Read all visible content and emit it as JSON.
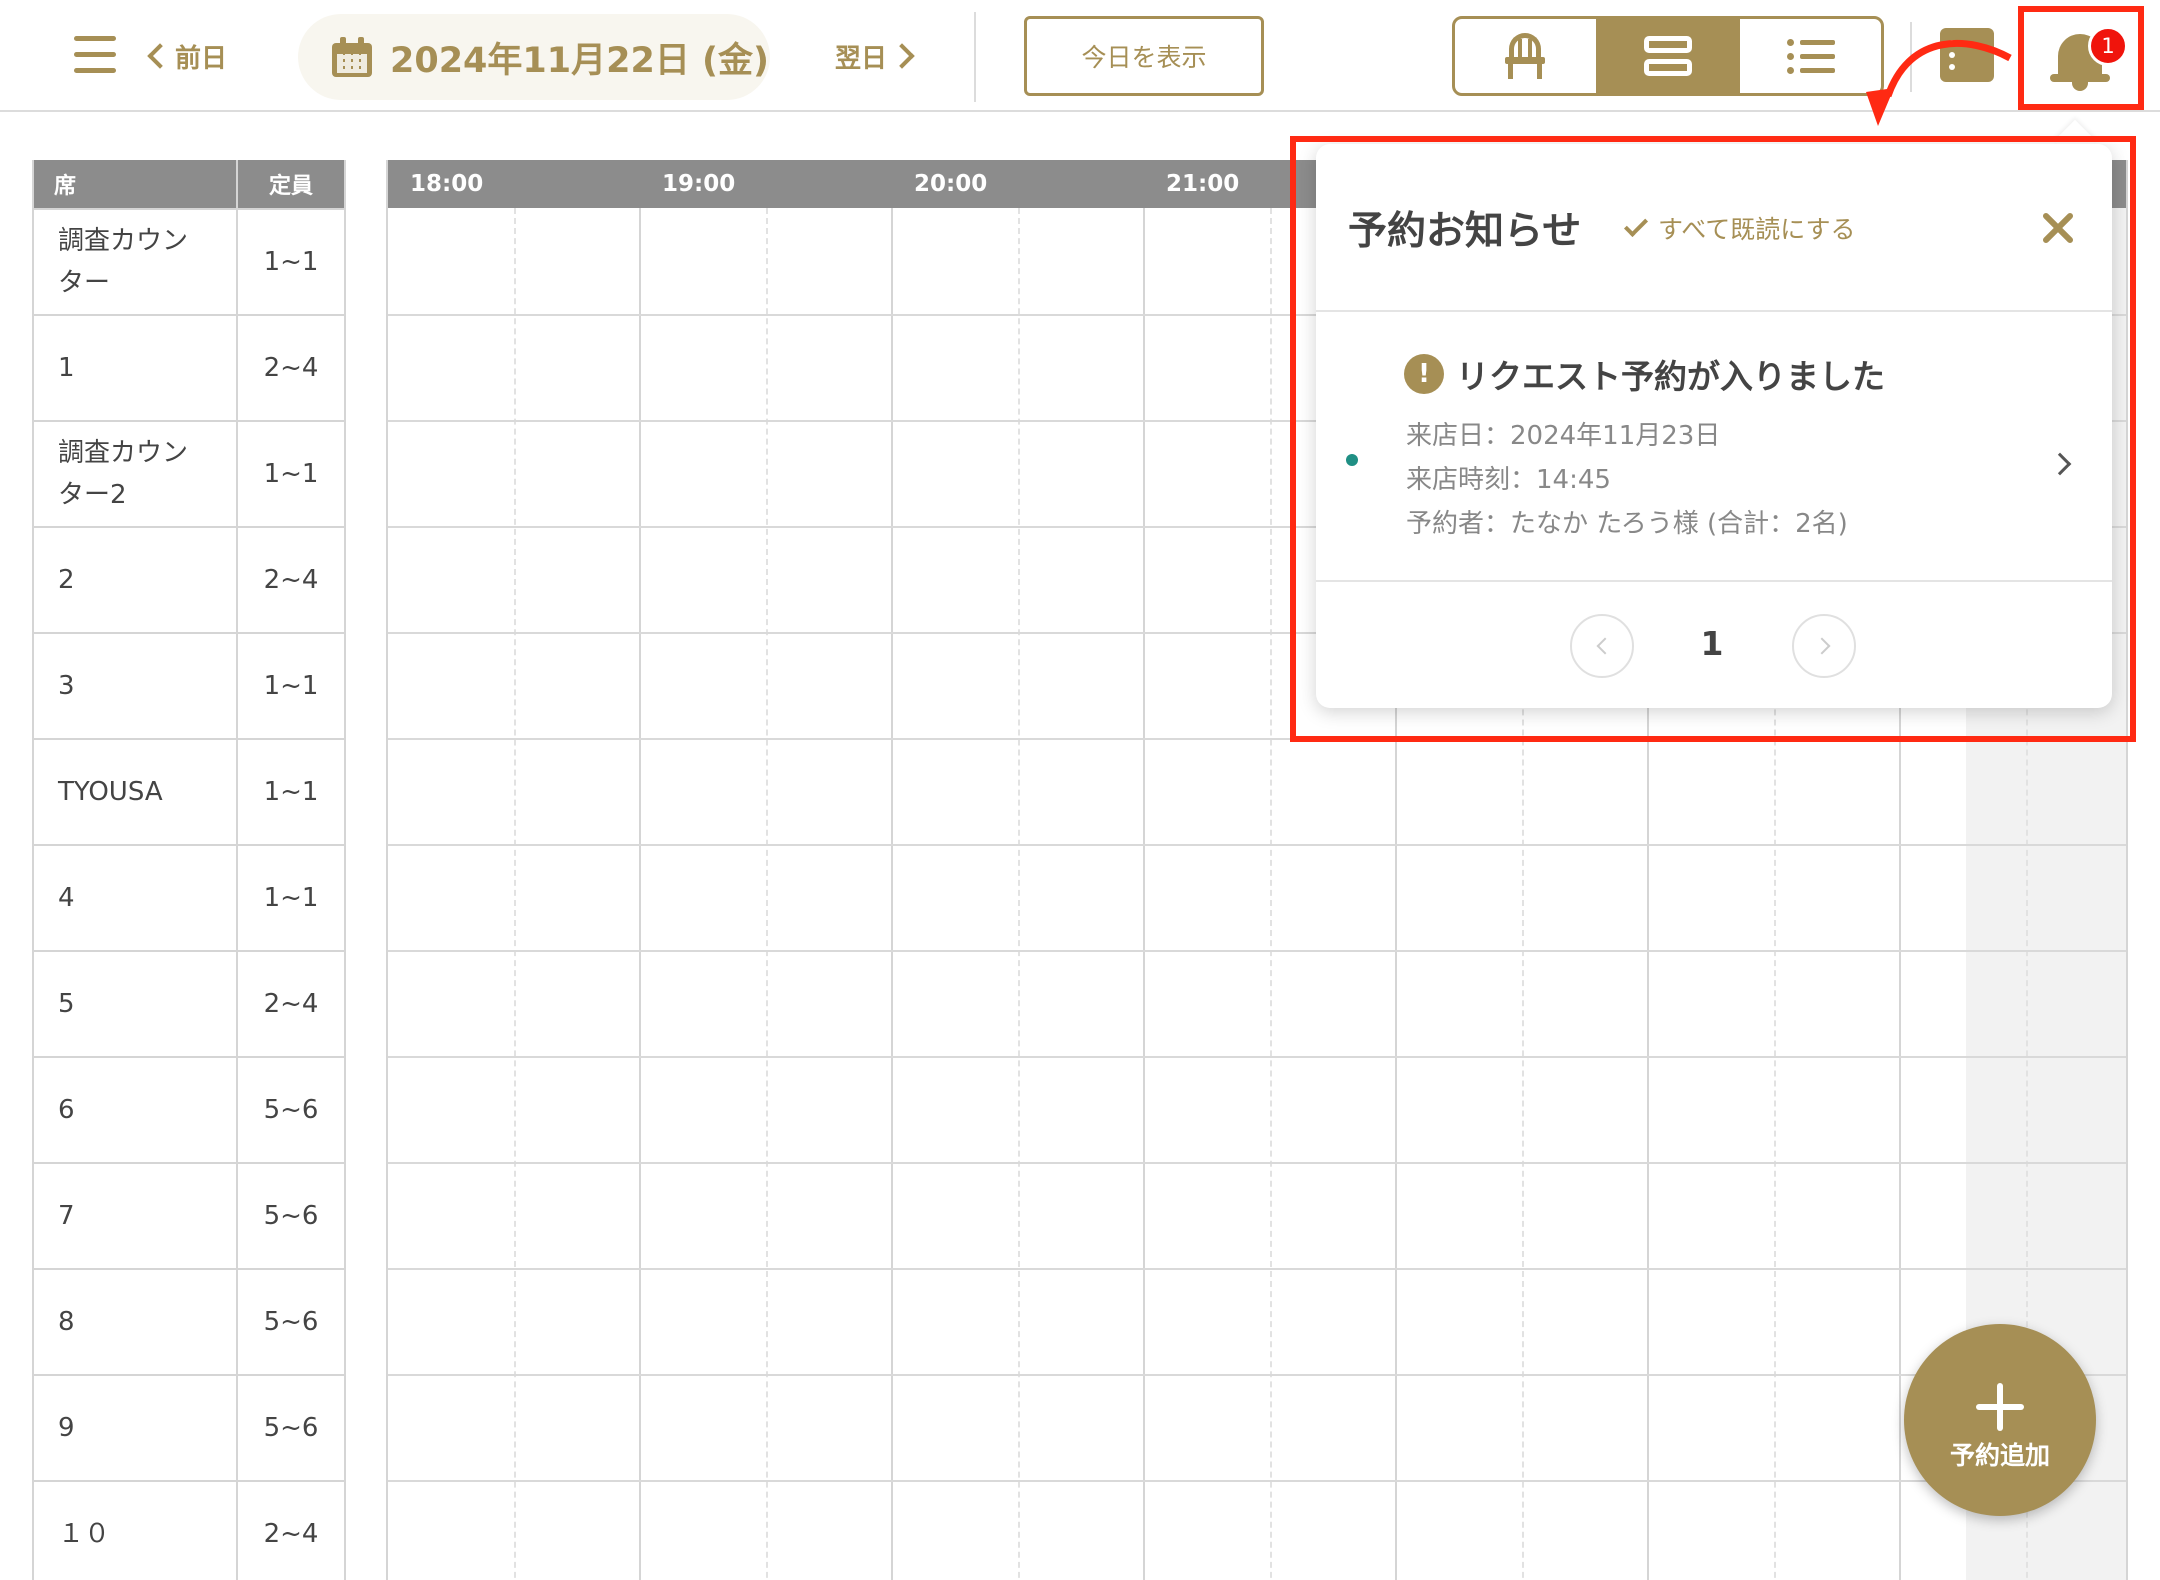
{
  "header": {
    "prev_label": "前日",
    "next_label": "翌日",
    "date": "2024年11月22日 (金)",
    "today_button": "今日を表示",
    "notification_count": "1",
    "view_modes": [
      "chair-icon",
      "rows-icon",
      "list-icon"
    ],
    "active_view": 1
  },
  "seat_table": {
    "col_seat": "席",
    "col_capacity": "定員",
    "rows": [
      {
        "name": "調査カウンター",
        "capacity": "1~1"
      },
      {
        "name": "1",
        "capacity": "2~4"
      },
      {
        "name": "調査カウンター2",
        "capacity": "1~1"
      },
      {
        "name": "2",
        "capacity": "2~4"
      },
      {
        "name": "3",
        "capacity": "1~1"
      },
      {
        "name": "TYOUSA",
        "capacity": "1~1"
      },
      {
        "name": "4",
        "capacity": "1~1"
      },
      {
        "name": "5",
        "capacity": "2~4"
      },
      {
        "name": "6",
        "capacity": "5~6"
      },
      {
        "name": "7",
        "capacity": "5~6"
      },
      {
        "name": "8",
        "capacity": "5~6"
      },
      {
        "name": "9",
        "capacity": "5~6"
      },
      {
        "name": "１０",
        "capacity": "2~4"
      }
    ]
  },
  "timeline": {
    "hours": [
      "18:00",
      "19:00",
      "20:00",
      "21:00"
    ]
  },
  "notifications": {
    "title": "予約お知らせ",
    "mark_all_read": "すべて既読にする",
    "items": [
      {
        "heading": "リクエスト予約が入りました",
        "visit_date": "来店日：2024年11月23日",
        "visit_time": "来店時刻：14:45",
        "booker": "予約者：たなか たろう様 (合計：2名)",
        "unread": true
      }
    ],
    "page": "1"
  },
  "fab": {
    "label": "予約追加"
  },
  "colors": {
    "accent": "#a68f55",
    "annotation": "#ff2a13",
    "badge": "#f0140c",
    "header_gray": "#8c8c8c",
    "unread_dot": "#1f8f84"
  }
}
